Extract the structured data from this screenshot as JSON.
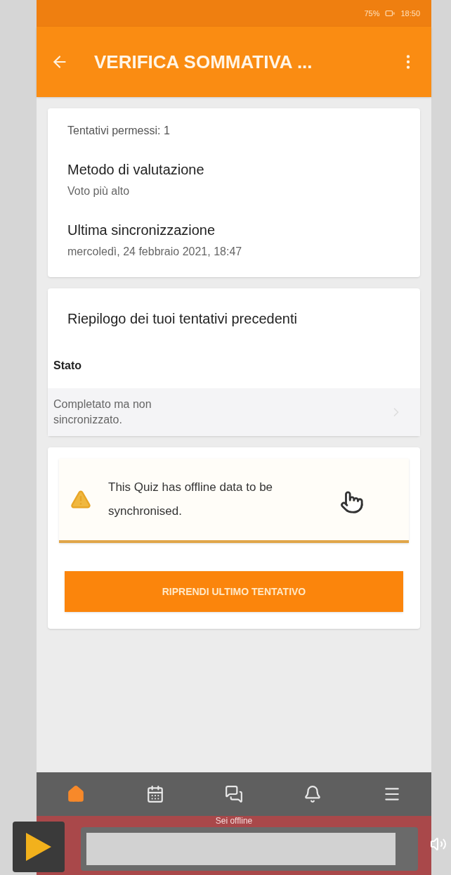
{
  "status_bar": {
    "battery": "75%",
    "time": "18:50"
  },
  "app_bar": {
    "title": "VERIFICA SOMMATIVA ..."
  },
  "info_card": {
    "attempts": "Tentativi permessi: 1",
    "fields": [
      {
        "label": "Metodo di valutazione",
        "value": "Voto più alto"
      },
      {
        "label": "Ultima sincronizzazione",
        "value": "mercoledì, 24 febbraio 2021, 18:47"
      }
    ]
  },
  "summary_card": {
    "title": "Riepilogo dei tuoi tentativi precedenti",
    "column": "Stato",
    "rows": [
      {
        "status": "Completato ma non sincronizzato."
      }
    ]
  },
  "warning": {
    "text": "This Quiz has offline data to be synchronised."
  },
  "action_button": "RIPRENDI ULTIMO TENTATIVO",
  "bottom_nav": [
    {
      "kind": "home",
      "selected": true
    },
    {
      "kind": "calendar",
      "selected": false
    },
    {
      "kind": "messages",
      "selected": false
    },
    {
      "kind": "notifications",
      "selected": false
    },
    {
      "kind": "menu",
      "selected": false
    }
  ],
  "offline_banner": "Sei offline"
}
